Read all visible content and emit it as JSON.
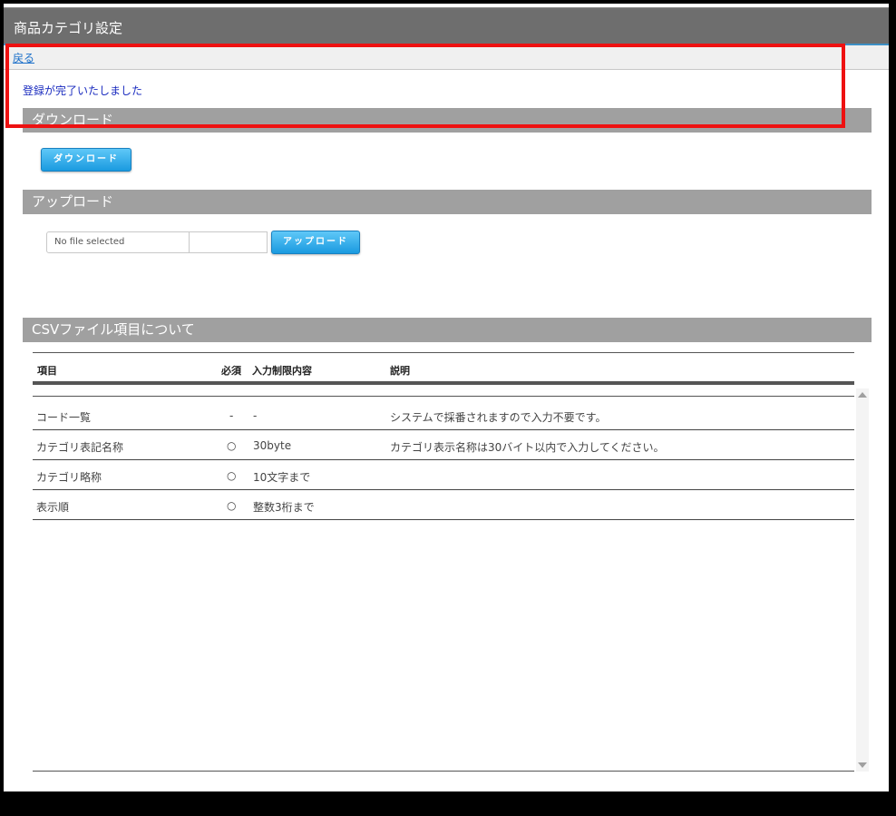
{
  "window": {
    "title": "商品カテゴリ設定"
  },
  "nav": {
    "back_label": "戻る"
  },
  "message": "登録が完了いたしました",
  "download": {
    "section_title": "ダウンロード",
    "button_label": "ダウンロード"
  },
  "upload": {
    "section_title": "アップロード",
    "file_placeholder": "No file selected",
    "button_label": "アップロード"
  },
  "csv": {
    "section_title": "CSVファイル項目について",
    "headers": [
      "項目",
      "必須",
      "入力制限内容",
      "説明"
    ],
    "rows": [
      [
        "コード一覧",
        "-",
        "-",
        "システムで採番されますので入力不要です。"
      ],
      [
        "カテゴリ表記名称",
        "○",
        "30byte",
        "カテゴリ表示名称は30バイト以内で入力してください。"
      ],
      [
        "カテゴリ略称",
        "○",
        "10文字まで",
        ""
      ],
      [
        "表示順",
        "○",
        "整数3桁まで",
        ""
      ]
    ]
  },
  "colors": {
    "highlight": "#ee1111",
    "button": "#1a9ae0",
    "section_bar": "#a0a0a0"
  }
}
